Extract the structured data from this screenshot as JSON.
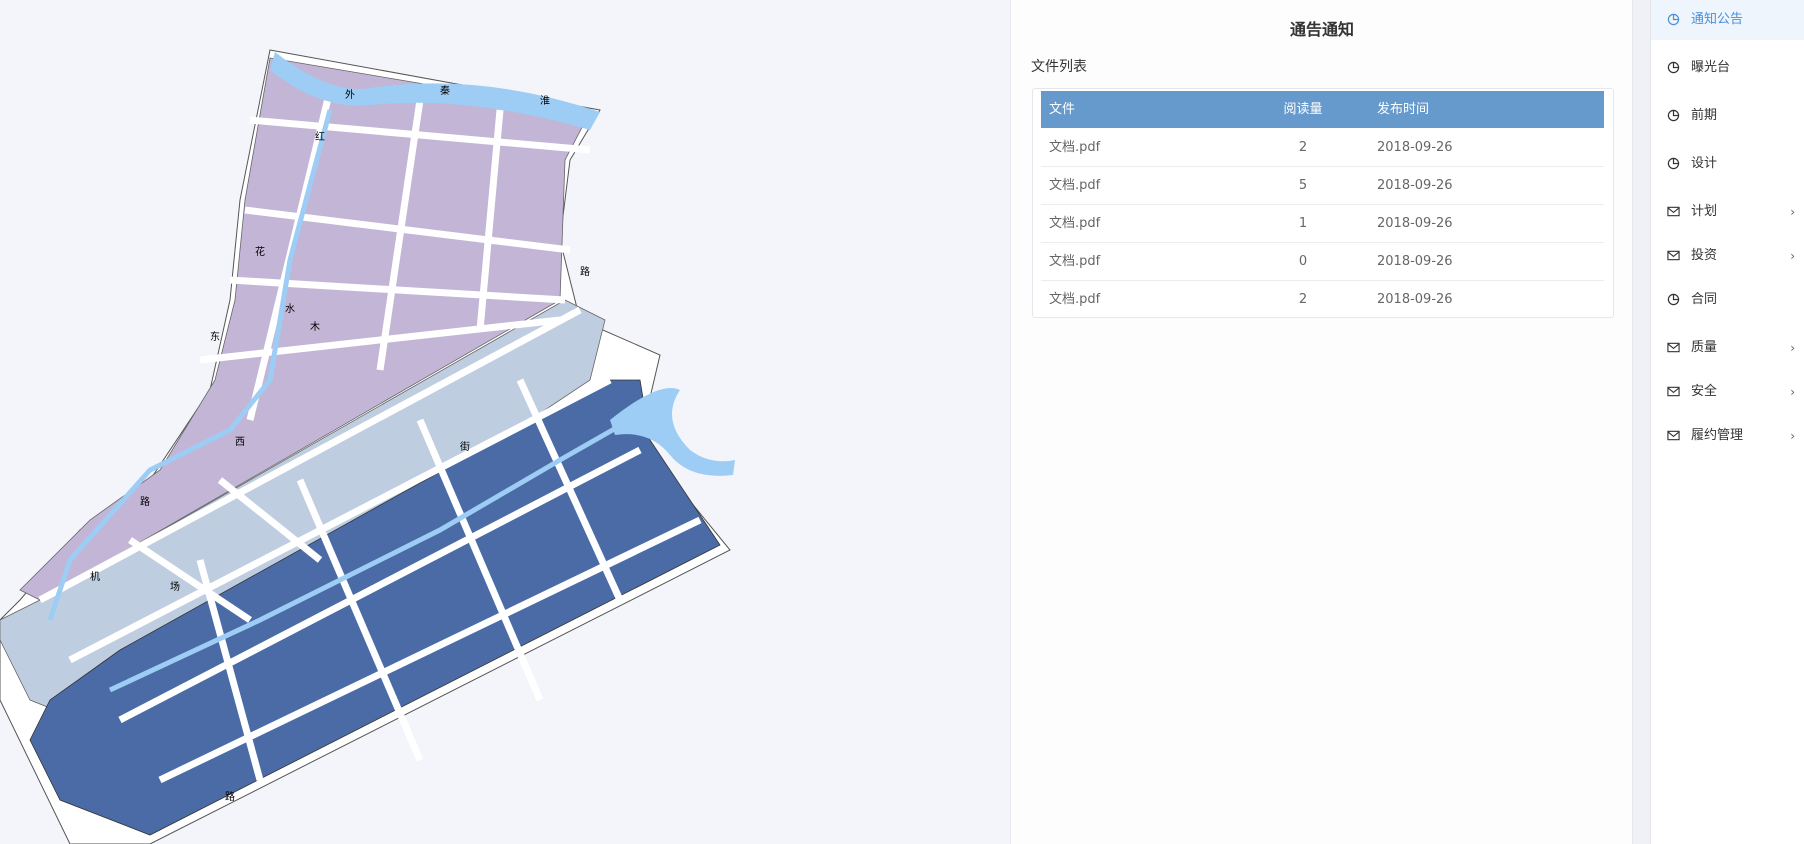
{
  "panel": {
    "title": "通告通知",
    "section_label": "文件列表",
    "columns": [
      "文件",
      "阅读量",
      "发布时间"
    ],
    "rows": [
      {
        "file": "文档.pdf",
        "reads": "2",
        "date": "2018-09-26"
      },
      {
        "file": "文档.pdf",
        "reads": "5",
        "date": "2018-09-26"
      },
      {
        "file": "文档.pdf",
        "reads": "1",
        "date": "2018-09-26"
      },
      {
        "file": "文档.pdf",
        "reads": "0",
        "date": "2018-09-26"
      },
      {
        "file": "文档.pdf",
        "reads": "2",
        "date": "2018-09-26"
      }
    ]
  },
  "sidebar": {
    "items": [
      {
        "label": "通知公告",
        "icon": "pie-chart-icon",
        "active": true,
        "expandable": false
      },
      {
        "label": "曝光台",
        "icon": "pie-chart-icon",
        "active": false,
        "expandable": false
      },
      {
        "label": "前期",
        "icon": "pie-chart-icon",
        "active": false,
        "expandable": false
      },
      {
        "label": "设计",
        "icon": "pie-chart-icon",
        "active": false,
        "expandable": false
      },
      {
        "label": "计划",
        "icon": "mail-icon",
        "active": false,
        "expandable": true
      },
      {
        "label": "投资",
        "icon": "mail-icon",
        "active": false,
        "expandable": true
      },
      {
        "label": "合同",
        "icon": "pie-chart-icon",
        "active": false,
        "expandable": false
      },
      {
        "label": "质量",
        "icon": "mail-icon",
        "active": false,
        "expandable": true
      },
      {
        "label": "安全",
        "icon": "mail-icon",
        "active": false,
        "expandable": true
      },
      {
        "label": "履约管理",
        "icon": "mail-icon",
        "active": false,
        "expandable": true
      }
    ]
  },
  "map": {
    "labels": [
      "秦",
      "淮",
      "外",
      "路",
      "红",
      "花",
      "路",
      "机",
      "场",
      "路",
      "水",
      "木",
      "西",
      "街",
      "东"
    ],
    "colors": {
      "district_north": "#c2b5d6",
      "district_middle": "#bfcde0",
      "district_south": "#4a6ba6",
      "water": "#9dcdf5",
      "road": "#ffffff",
      "outline": "#555555",
      "river_label": "#e040e0"
    }
  }
}
